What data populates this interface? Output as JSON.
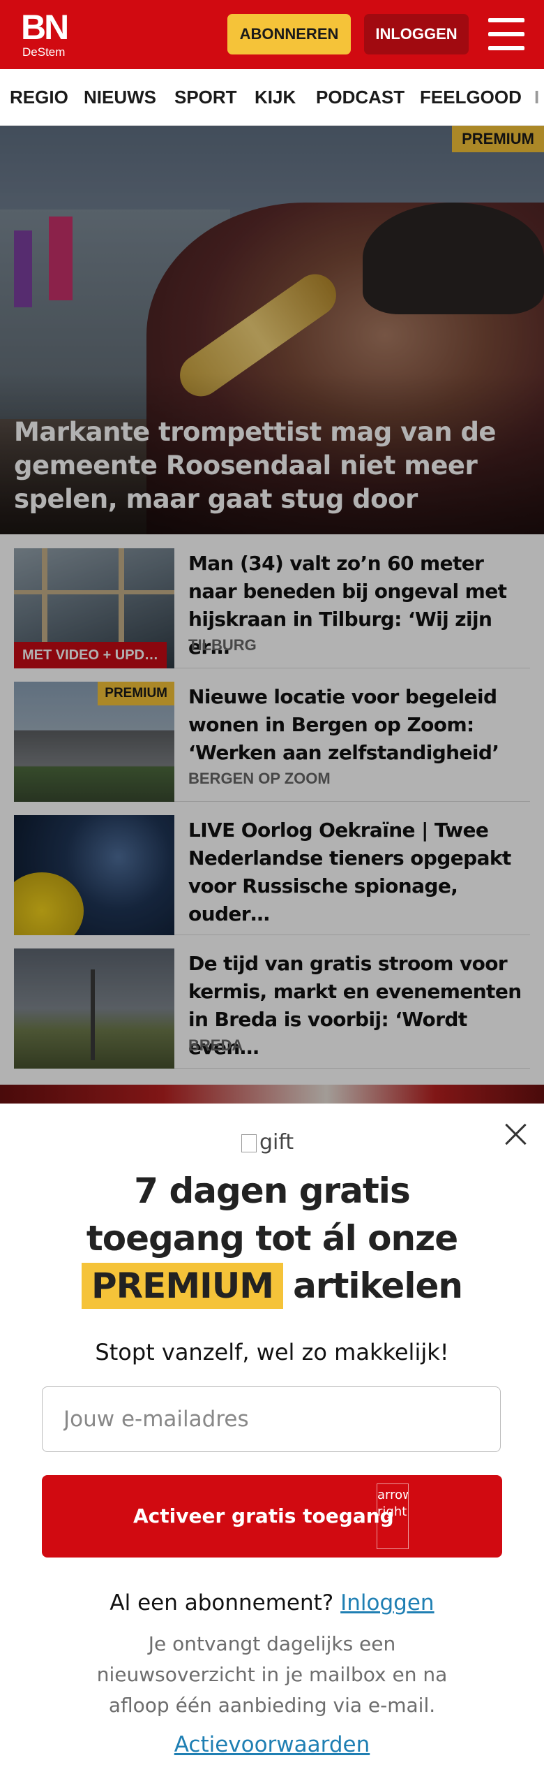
{
  "header": {
    "logo_main": "BN",
    "logo_sub": "DeStem",
    "subscribe_label": "ABONNEREN",
    "login_label": "INLOGGEN",
    "menu_icon": "hamburger-menu-icon",
    "brand_color": "#d10a11",
    "accent_color": "#f5c339"
  },
  "nav": {
    "items": [
      "REGIO",
      "NIEUWS",
      "SPORT",
      "KIJK",
      "PODCAST",
      "FEELGOOD",
      "I"
    ]
  },
  "hero": {
    "badge": "PREMIUM",
    "title": "Markante trompettist mag van de gemeente Roosendaal niet meer spelen, maar gaat stug door"
  },
  "articles": [
    {
      "title": "Man (34) valt zo’n 60 meter naar beneden bij ongeval met hijskraan in Tilburg: ‘Wij zijn er…",
      "tag": "TILBURG",
      "thumb_label": "MET VIDEO + UPD…"
    },
    {
      "title": "Nieuwe locatie voor begeleid wonen in Bergen op Zoom: ‘Werken aan zelfstandigheid’",
      "tag": "BERGEN OP ZOOM",
      "thumb_badge": "PREMIUM"
    },
    {
      "title": "LIVE Oorlog Oekraïne | Twee Nederlandse tieners opgepakt voor Russische spionage, ouder…",
      "tag": ""
    },
    {
      "title": "De tijd van gratis stroom voor kermis, markt en evenementen in Breda is voorbij: ‘Wordt even…",
      "tag": "BREDA"
    }
  ],
  "modal": {
    "gift_alt": "gift",
    "headline_line1": "7 dagen gratis",
    "headline_line2": "toegang tot ál onze",
    "headline_premium": "PREMIUM",
    "headline_tail": "artikelen",
    "subline": "Stopt vanzelf, wel zo makkelijk!",
    "email_placeholder": "Jouw e-mailadres",
    "email_value": "",
    "cta_label": "Activeer gratis toegang",
    "cta_icon_alt": "arrow-right",
    "cta_icon": "arrow-right-icon",
    "already_text": "Al een abonnement?",
    "already_link": "Inloggen",
    "info_text": "Je ontvangt dagelijks een nieuwsoverzicht in je mailbox en na afloop één aanbieding via e-mail.",
    "terms_link": "Actievoorwaarden",
    "close_icon": "close-icon"
  }
}
